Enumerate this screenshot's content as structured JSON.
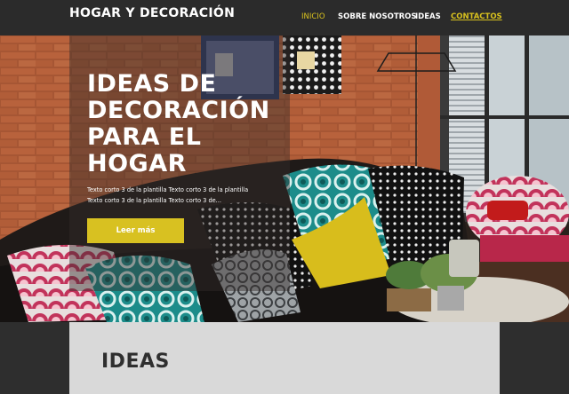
{
  "header": {
    "brand": "HOGAR Y DECORACIÓN",
    "nav": [
      {
        "label": "INICIO",
        "state": "active"
      },
      {
        "label": "SOBRE NOSOTROS",
        "state": "normal"
      },
      {
        "label": "IDEAS",
        "state": "normal"
      },
      {
        "label": "CONTACTOS",
        "state": "underlined"
      }
    ]
  },
  "hero": {
    "title": "IDEAS DE DECORACIÓN PARA EL HOGAR",
    "text": "Texto corto 3 de la plantilla Texto corto 3 de la plantilla Texto corto 3 de la plantilla Texto corto 3 de...",
    "button": "Leer más",
    "image": "living-room-photo"
  },
  "section": {
    "title": "IDEAS"
  },
  "colors": {
    "accent": "#d8c121",
    "background": "#2e2e2e",
    "section_bg": "#d9d9d9"
  }
}
